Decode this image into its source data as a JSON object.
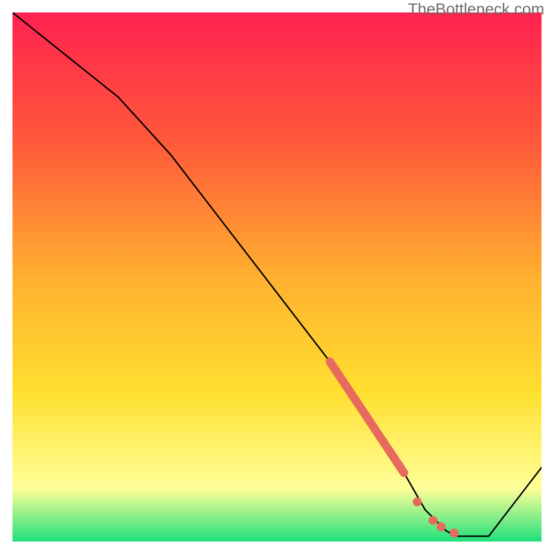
{
  "watermark": "TheBottleneck.com",
  "colors": {
    "gradient_top": "#ff2250",
    "gradient_upper": "#ff5a3a",
    "gradient_mid": "#ffb030",
    "gradient_lower": "#ffe030",
    "gradient_pale": "#ffff99",
    "gradient_bottom": "#1fe07a",
    "curve": "#000000",
    "marker": "#e86a5e"
  },
  "chart_data": {
    "type": "line",
    "title": "",
    "xlabel": "",
    "ylabel": "",
    "xlim": [
      0,
      100
    ],
    "ylim": [
      0,
      100
    ],
    "curve": {
      "name": "bottleneck-curve",
      "x": [
        0,
        10,
        20,
        30,
        40,
        50,
        60,
        65,
        70,
        74,
        78,
        82,
        84,
        86,
        90,
        100
      ],
      "y": [
        100,
        92,
        84,
        73,
        60,
        47,
        34,
        27,
        20,
        13,
        6,
        2,
        1,
        1,
        1,
        14
      ]
    },
    "markers": {
      "name": "highlight-segment",
      "thick_segment": {
        "x": [
          60,
          74
        ],
        "y": [
          34,
          13
        ]
      },
      "dots": [
        {
          "x": 76.5,
          "y": 7.5
        },
        {
          "x": 79.5,
          "y": 4.0
        },
        {
          "x": 81.0,
          "y": 2.8
        },
        {
          "x": 83.5,
          "y": 1.6
        }
      ]
    },
    "gradient_stops": [
      {
        "offset": 0.0,
        "color_key": "gradient_top"
      },
      {
        "offset": 0.25,
        "color_key": "gradient_upper"
      },
      {
        "offset": 0.5,
        "color_key": "gradient_mid"
      },
      {
        "offset": 0.72,
        "color_key": "gradient_lower"
      },
      {
        "offset": 0.9,
        "color_key": "gradient_pale"
      },
      {
        "offset": 1.0,
        "color_key": "gradient_bottom"
      }
    ]
  }
}
